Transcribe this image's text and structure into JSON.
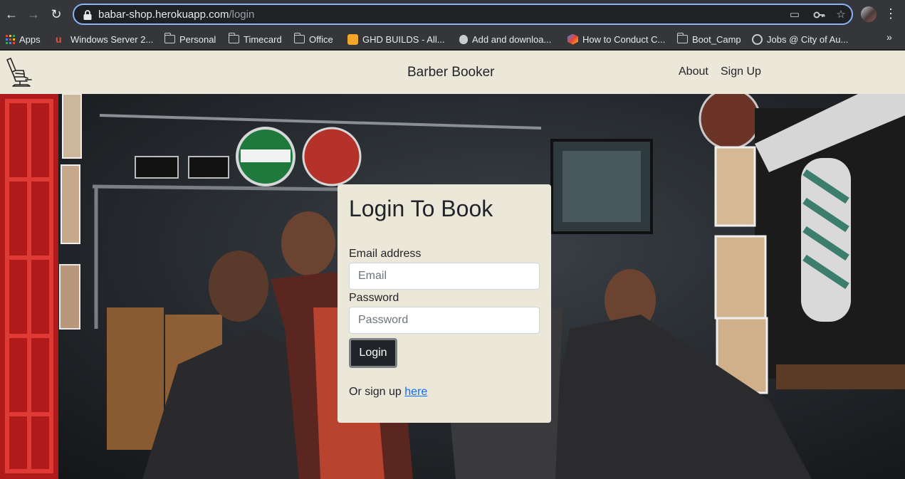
{
  "browser": {
    "url_host": "babar-shop.herokuapp.com",
    "url_path": "/login",
    "bookmarks": [
      {
        "label": "Apps",
        "icon": "apps-grid-icon"
      },
      {
        "label": "Windows Server 2...",
        "icon": "windows-server-icon"
      },
      {
        "label": "Personal",
        "icon": "folder-icon"
      },
      {
        "label": "Timecard",
        "icon": "folder-icon"
      },
      {
        "label": "Office",
        "icon": "folder-icon"
      },
      {
        "label": "GHD BUILDS - All...",
        "icon": "ghd-builds-icon"
      },
      {
        "label": "Add and downloa...",
        "icon": "apple-icon"
      },
      {
        "label": "How to Conduct C...",
        "icon": "hexagon-icon"
      },
      {
        "label": "Boot_Camp",
        "icon": "folder-icon"
      },
      {
        "label": "Jobs @ City of Au...",
        "icon": "globe-icon"
      }
    ]
  },
  "navbar": {
    "brand": "Barber Booker",
    "about": "About",
    "signup": "Sign Up"
  },
  "login": {
    "title": "Login To Book",
    "email_label": "Email address",
    "email_placeholder": "Email",
    "password_label": "Password",
    "password_placeholder": "Password",
    "button": "Login",
    "signup_prefix": "Or sign up ",
    "signup_link": "here"
  },
  "colors": {
    "navbar_bg": "#ebe7d9",
    "card_bg": "#ebe7d9",
    "button_bg": "#212529",
    "link": "#0d6efd"
  }
}
